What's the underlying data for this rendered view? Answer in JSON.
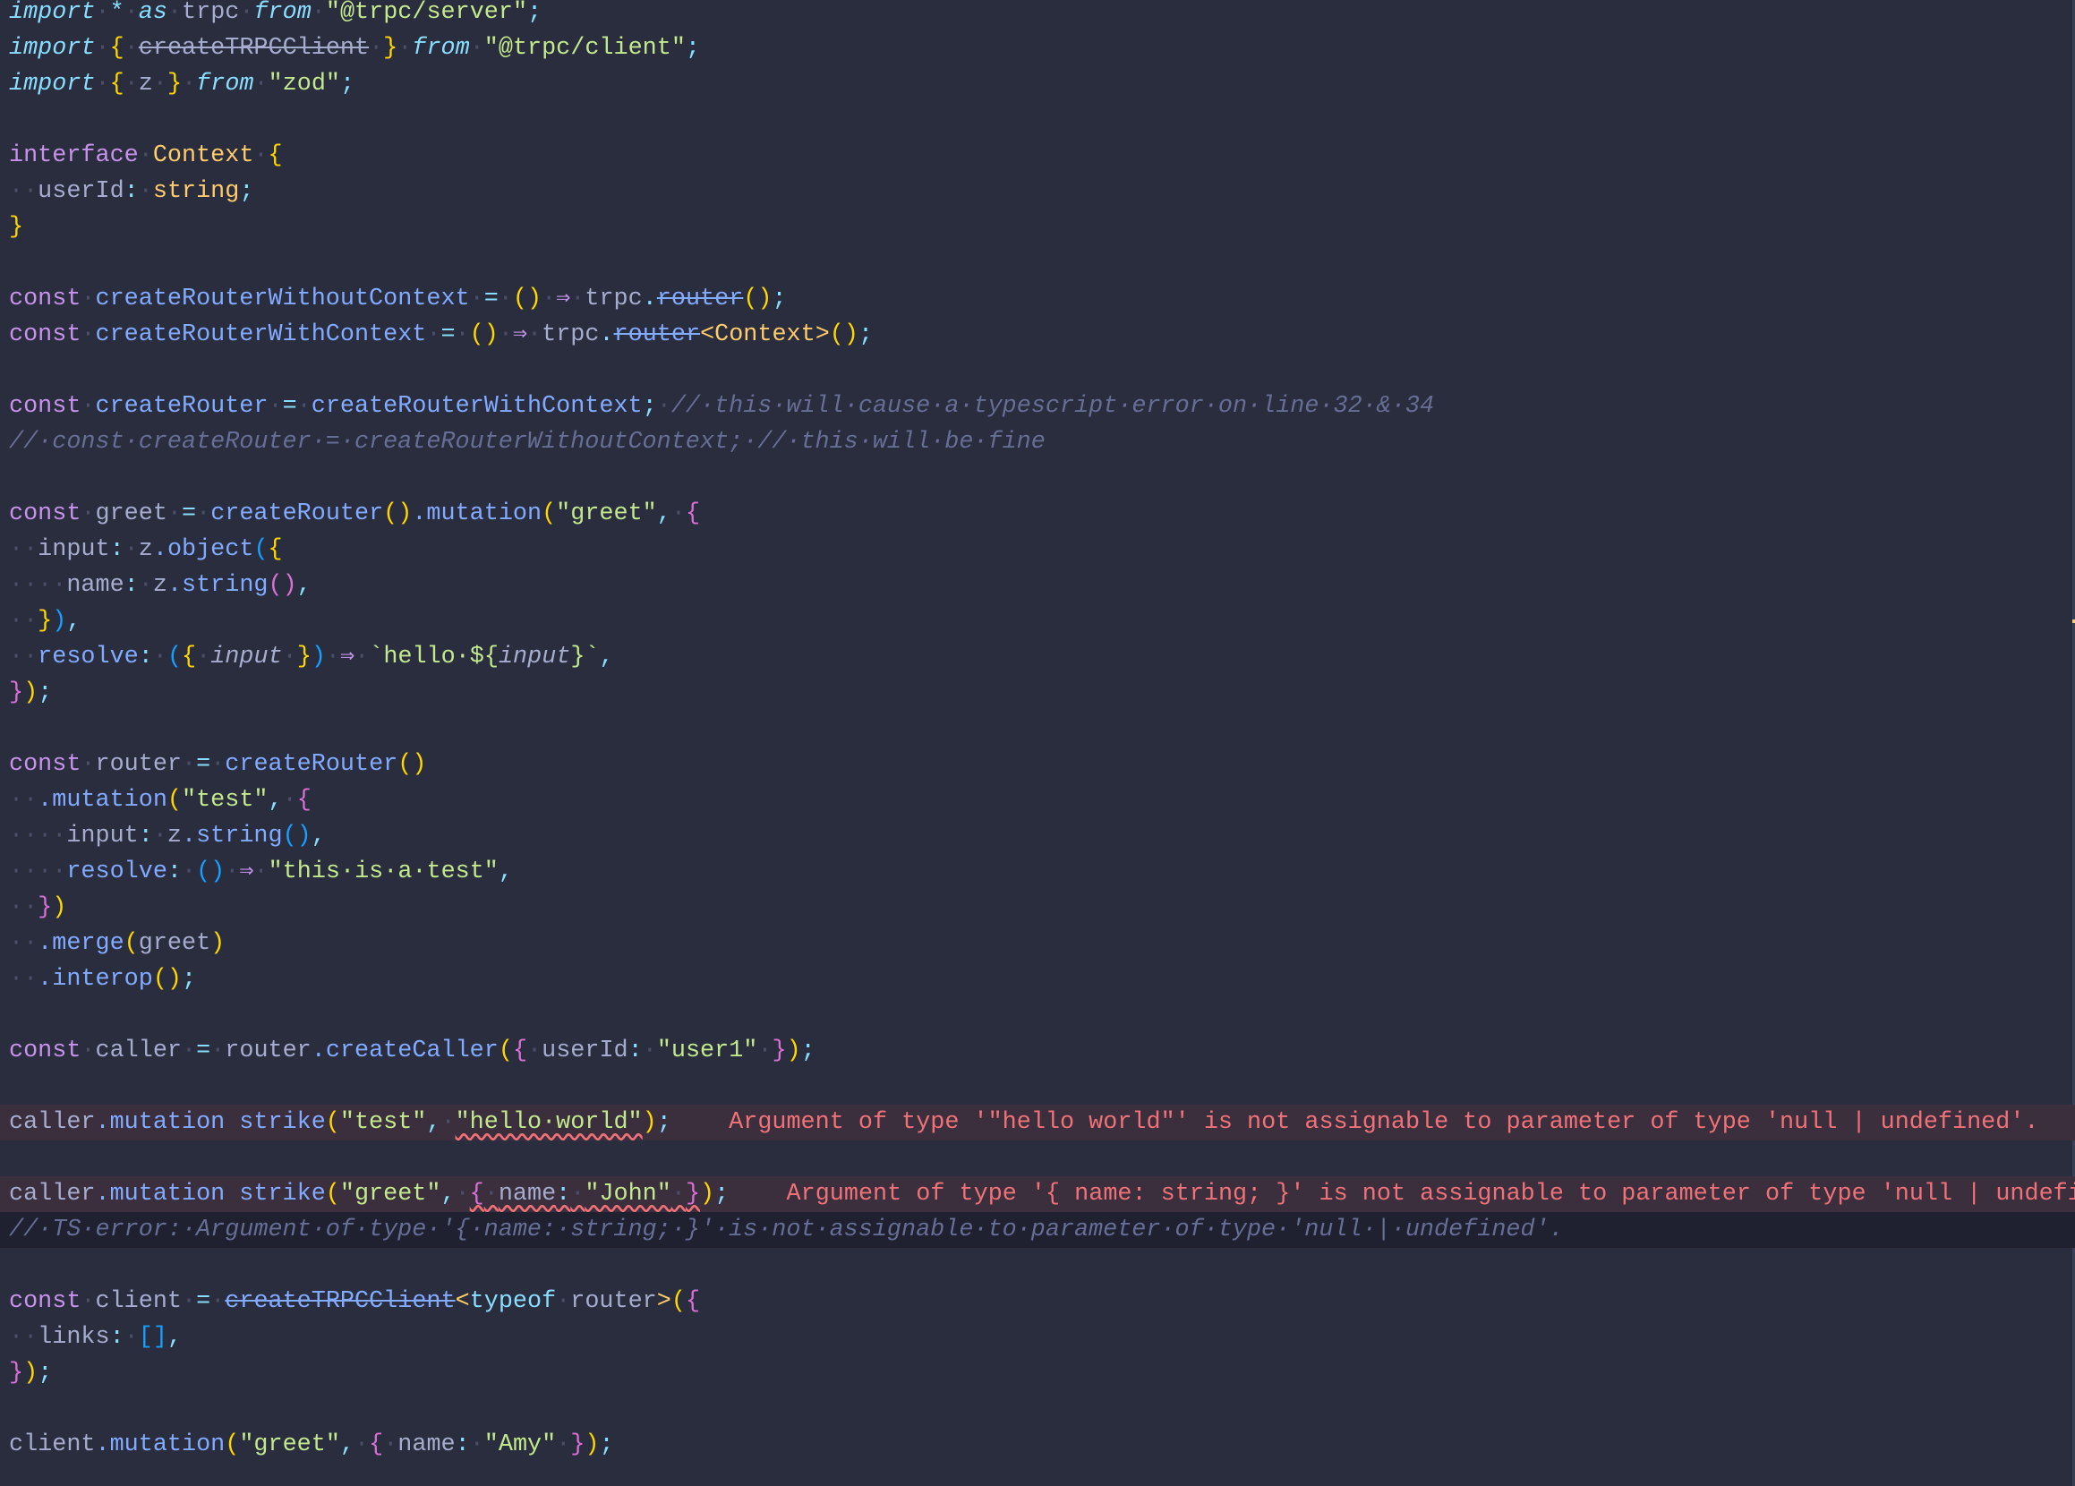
{
  "editor": {
    "language": "typescript",
    "lines": [
      {
        "tokens": [
          [
            "kwi",
            "import"
          ],
          [
            "ws",
            "·"
          ],
          [
            "op",
            "*"
          ],
          [
            "ws",
            "·"
          ],
          [
            "kwi",
            "as"
          ],
          [
            "ws",
            "·"
          ],
          [
            "var",
            "trpc"
          ],
          [
            "ws",
            "·"
          ],
          [
            "kwi",
            "from"
          ],
          [
            "ws",
            "·"
          ],
          [
            "str",
            "\"@trpc/server\""
          ],
          [
            "op",
            ";"
          ]
        ]
      },
      {
        "tokens": [
          [
            "kwi",
            "import"
          ],
          [
            "ws",
            "·"
          ],
          [
            "br1",
            "{"
          ],
          [
            "ws",
            "·"
          ],
          [
            "var strike",
            "createTRPCClient"
          ],
          [
            "ws",
            "·"
          ],
          [
            "br1",
            "}"
          ],
          [
            "ws",
            "·"
          ],
          [
            "kwi",
            "from"
          ],
          [
            "ws",
            "·"
          ],
          [
            "str",
            "\"@trpc/client\""
          ],
          [
            "op",
            ";"
          ]
        ]
      },
      {
        "tokens": [
          [
            "kwi",
            "import"
          ],
          [
            "ws",
            "·"
          ],
          [
            "br1",
            "{"
          ],
          [
            "ws",
            "·"
          ],
          [
            "var",
            "z"
          ],
          [
            "ws",
            "·"
          ],
          [
            "br1",
            "}"
          ],
          [
            "ws",
            "·"
          ],
          [
            "kwi",
            "from"
          ],
          [
            "ws",
            "·"
          ],
          [
            "str",
            "\"zod\""
          ],
          [
            "op",
            ";"
          ]
        ]
      },
      {
        "tokens": []
      },
      {
        "tokens": [
          [
            "kw",
            "interface"
          ],
          [
            "ws",
            "·"
          ],
          [
            "type",
            "Context"
          ],
          [
            "ws",
            "·"
          ],
          [
            "br1",
            "{"
          ]
        ]
      },
      {
        "tokens": [
          [
            "ws",
            "··"
          ],
          [
            "prop",
            "userId"
          ],
          [
            "op",
            ":"
          ],
          [
            "ws",
            "·"
          ],
          [
            "type",
            "string"
          ],
          [
            "op",
            ";"
          ]
        ]
      },
      {
        "tokens": [
          [
            "br1",
            "}"
          ]
        ]
      },
      {
        "tokens": []
      },
      {
        "tokens": [
          [
            "kw",
            "const"
          ],
          [
            "ws",
            "·"
          ],
          [
            "fn",
            "createRouterWithoutContext"
          ],
          [
            "ws",
            "·"
          ],
          [
            "op",
            "="
          ],
          [
            "ws",
            "·"
          ],
          [
            "br1",
            "()"
          ],
          [
            "ws",
            "·"
          ],
          [
            "arrow",
            "⇒"
          ],
          [
            "ws",
            "·"
          ],
          [
            "var",
            "trpc"
          ],
          [
            "op",
            "."
          ],
          [
            "fn strike",
            "router"
          ],
          [
            "br1",
            "()"
          ],
          [
            "op",
            ";"
          ]
        ]
      },
      {
        "tokens": [
          [
            "kw",
            "const"
          ],
          [
            "ws",
            "·"
          ],
          [
            "fn",
            "createRouterWithContext"
          ],
          [
            "ws",
            "·"
          ],
          [
            "op",
            "="
          ],
          [
            "ws",
            "·"
          ],
          [
            "br1",
            "()"
          ],
          [
            "ws",
            "·"
          ],
          [
            "arrow",
            "⇒"
          ],
          [
            "ws",
            "·"
          ],
          [
            "var",
            "trpc"
          ],
          [
            "op",
            "."
          ],
          [
            "fn strike",
            "router"
          ],
          [
            "type",
            "<Context>"
          ],
          [
            "br1",
            "()"
          ],
          [
            "op",
            ";"
          ]
        ]
      },
      {
        "tokens": []
      },
      {
        "tokens": [
          [
            "kw",
            "const"
          ],
          [
            "ws",
            "·"
          ],
          [
            "fn",
            "createRouter"
          ],
          [
            "ws",
            "·"
          ],
          [
            "op",
            "="
          ],
          [
            "ws",
            "·"
          ],
          [
            "fn",
            "createRouterWithContext"
          ],
          [
            "op",
            ";"
          ],
          [
            "ws",
            "·"
          ],
          [
            "cmt",
            "//·this·will·cause·a·typescript·error·on·line·32·&·34"
          ]
        ]
      },
      {
        "tokens": [
          [
            "cmt",
            "//·const·createRouter·=·createRouterWithoutContext;·//·this·will·be·fine"
          ]
        ]
      },
      {
        "tokens": []
      },
      {
        "tokens": [
          [
            "kw",
            "const"
          ],
          [
            "ws",
            "·"
          ],
          [
            "var",
            "greet"
          ],
          [
            "ws",
            "·"
          ],
          [
            "op",
            "="
          ],
          [
            "ws",
            "·"
          ],
          [
            "fn",
            "createRouter"
          ],
          [
            "br1",
            "()"
          ],
          [
            "fn",
            ".mutation"
          ],
          [
            "br1",
            "("
          ],
          [
            "str",
            "\"greet\""
          ],
          [
            "op",
            ","
          ],
          [
            "ws",
            "·"
          ],
          [
            "br2",
            "{"
          ]
        ]
      },
      {
        "tokens": [
          [
            "ws",
            "··"
          ],
          [
            "prop",
            "input"
          ],
          [
            "op",
            ":"
          ],
          [
            "ws",
            "·"
          ],
          [
            "var",
            "z"
          ],
          [
            "fn",
            ".object"
          ],
          [
            "br3",
            "("
          ],
          [
            "br1",
            "{"
          ]
        ]
      },
      {
        "tokens": [
          [
            "ws",
            "····"
          ],
          [
            "prop",
            "name"
          ],
          [
            "op",
            ":"
          ],
          [
            "ws",
            "·"
          ],
          [
            "var",
            "z"
          ],
          [
            "fn",
            ".string"
          ],
          [
            "br2",
            "()"
          ],
          [
            "op",
            ","
          ]
        ]
      },
      {
        "tokens": [
          [
            "ws",
            "··"
          ],
          [
            "br1",
            "}"
          ],
          [
            "br3",
            ")"
          ],
          [
            "op",
            ","
          ]
        ]
      },
      {
        "tokens": [
          [
            "ws",
            "··"
          ],
          [
            "fn",
            "resolve"
          ],
          [
            "op",
            ":"
          ],
          [
            "ws",
            "·"
          ],
          [
            "br3",
            "("
          ],
          [
            "br1",
            "{"
          ],
          [
            "ws",
            "·"
          ],
          [
            "var ital",
            "input"
          ],
          [
            "ws",
            "·"
          ],
          [
            "br1",
            "}"
          ],
          [
            "br3",
            ")"
          ],
          [
            "ws",
            "·"
          ],
          [
            "arrow",
            "⇒"
          ],
          [
            "ws",
            "·"
          ],
          [
            "str",
            "`hello·${"
          ],
          [
            "var ital",
            "input"
          ],
          [
            "str",
            "}`"
          ],
          [
            "op",
            ","
          ]
        ]
      },
      {
        "tokens": [
          [
            "br2",
            "}"
          ],
          [
            "br1",
            ")"
          ],
          [
            "op",
            ";"
          ]
        ]
      },
      {
        "tokens": []
      },
      {
        "tokens": [
          [
            "kw",
            "const"
          ],
          [
            "ws",
            "·"
          ],
          [
            "var",
            "router"
          ],
          [
            "ws",
            "·"
          ],
          [
            "op",
            "="
          ],
          [
            "ws",
            "·"
          ],
          [
            "fn",
            "createRouter"
          ],
          [
            "br1",
            "()"
          ]
        ]
      },
      {
        "tokens": [
          [
            "ws",
            "··"
          ],
          [
            "fn",
            ".mutation"
          ],
          [
            "br1",
            "("
          ],
          [
            "str",
            "\"test\""
          ],
          [
            "op",
            ","
          ],
          [
            "ws",
            "·"
          ],
          [
            "br2",
            "{"
          ]
        ]
      },
      {
        "tokens": [
          [
            "ws",
            "····"
          ],
          [
            "prop",
            "input"
          ],
          [
            "op",
            ":"
          ],
          [
            "ws",
            "·"
          ],
          [
            "var",
            "z"
          ],
          [
            "fn",
            ".string"
          ],
          [
            "br3",
            "()"
          ],
          [
            "op",
            ","
          ]
        ]
      },
      {
        "tokens": [
          [
            "ws",
            "····"
          ],
          [
            "fn",
            "resolve"
          ],
          [
            "op",
            ":"
          ],
          [
            "ws",
            "·"
          ],
          [
            "br3",
            "()"
          ],
          [
            "ws",
            "·"
          ],
          [
            "arrow",
            "⇒"
          ],
          [
            "ws",
            "·"
          ],
          [
            "str",
            "\"this·is·a·test\""
          ],
          [
            "op",
            ","
          ]
        ]
      },
      {
        "tokens": [
          [
            "ws",
            "··"
          ],
          [
            "br2",
            "}"
          ],
          [
            "br1",
            ")"
          ]
        ]
      },
      {
        "tokens": [
          [
            "ws",
            "··"
          ],
          [
            "fn",
            ".merge"
          ],
          [
            "br1",
            "("
          ],
          [
            "var",
            "greet"
          ],
          [
            "br1",
            ")"
          ]
        ]
      },
      {
        "tokens": [
          [
            "ws",
            "··"
          ],
          [
            "fn",
            ".interop"
          ],
          [
            "br1",
            "()"
          ],
          [
            "op",
            ";"
          ]
        ]
      },
      {
        "tokens": []
      },
      {
        "tokens": [
          [
            "kw",
            "const"
          ],
          [
            "ws",
            "·"
          ],
          [
            "var",
            "caller"
          ],
          [
            "ws",
            "·"
          ],
          [
            "op",
            "="
          ],
          [
            "ws",
            "·"
          ],
          [
            "var",
            "router"
          ],
          [
            "fn",
            ".createCaller"
          ],
          [
            "br1",
            "("
          ],
          [
            "br2",
            "{"
          ],
          [
            "ws",
            "·"
          ],
          [
            "prop",
            "userId"
          ],
          [
            "op",
            ":"
          ],
          [
            "ws",
            "·"
          ],
          [
            "str",
            "\"user1\""
          ],
          [
            "ws",
            "·"
          ],
          [
            "br2",
            "}"
          ],
          [
            "br1",
            ")"
          ],
          [
            "op",
            ";"
          ]
        ]
      },
      {
        "tokens": []
      },
      {
        "style": "err",
        "tokens": [
          [
            "var",
            "caller"
          ],
          [
            "fn",
            ".mutation strike"
          ],
          [
            "br1",
            "("
          ],
          [
            "str",
            "\"test\""
          ],
          [
            "op",
            ","
          ],
          [
            "ws",
            "·"
          ],
          [
            "str squig",
            "\"hello·world\""
          ],
          [
            "br1",
            ")"
          ],
          [
            "op",
            ";"
          ],
          [
            "errmsg",
            "    Argument of type '\"hello world\"' is not assignable to parameter of type 'null | undefined'."
          ]
        ]
      },
      {
        "tokens": []
      },
      {
        "style": "err",
        "tokens": [
          [
            "var",
            "caller"
          ],
          [
            "fn",
            ".mutation strike"
          ],
          [
            "br1",
            "("
          ],
          [
            "str",
            "\"greet\""
          ],
          [
            "op",
            ","
          ],
          [
            "ws",
            "·"
          ],
          [
            "br2 squig",
            "{"
          ],
          [
            "ws squig",
            "·"
          ],
          [
            "prop squig",
            "name"
          ],
          [
            "op squig",
            ":"
          ],
          [
            "ws squig",
            "·"
          ],
          [
            "str squig",
            "\"John\""
          ],
          [
            "ws squig",
            "·"
          ],
          [
            "br2 squig",
            "}"
          ],
          [
            "br1",
            ")"
          ],
          [
            "op",
            ";"
          ],
          [
            "errmsg",
            "    Argument of type '{ name: string; }' is not assignable to parameter of type 'null | undefined'."
          ]
        ]
      },
      {
        "style": "cmtbg",
        "tokens": [
          [
            "cmt",
            "//·TS·error:·Argument·of·type·'{·name:·string;·}'·is·not·assignable·to·parameter·of·type·'null·|·undefined'."
          ]
        ]
      },
      {
        "tokens": []
      },
      {
        "tokens": [
          [
            "kw",
            "const"
          ],
          [
            "ws",
            "·"
          ],
          [
            "var",
            "client"
          ],
          [
            "ws",
            "·"
          ],
          [
            "op",
            "="
          ],
          [
            "ws",
            "·"
          ],
          [
            "fn strike",
            "createTRPCClient"
          ],
          [
            "type",
            "<"
          ],
          [
            "op",
            "typeof"
          ],
          [
            "ws",
            "·"
          ],
          [
            "var",
            "router"
          ],
          [
            "type",
            ">"
          ],
          [
            "br1",
            "("
          ],
          [
            "br2",
            "{"
          ]
        ]
      },
      {
        "tokens": [
          [
            "ws",
            "··"
          ],
          [
            "prop",
            "links"
          ],
          [
            "op",
            ":"
          ],
          [
            "ws",
            "·"
          ],
          [
            "br3",
            "[]"
          ],
          [
            "op",
            ","
          ]
        ]
      },
      {
        "tokens": [
          [
            "br2",
            "}"
          ],
          [
            "br1",
            ")"
          ],
          [
            "op",
            ";"
          ]
        ]
      },
      {
        "tokens": []
      },
      {
        "tokens": [
          [
            "var",
            "client"
          ],
          [
            "fn",
            ".mutation"
          ],
          [
            "br1",
            "("
          ],
          [
            "str",
            "\"greet\""
          ],
          [
            "op",
            ","
          ],
          [
            "ws",
            "·"
          ],
          [
            "br2",
            "{"
          ],
          [
            "ws",
            "·"
          ],
          [
            "prop",
            "name"
          ],
          [
            "op",
            ":"
          ],
          [
            "ws",
            "·"
          ],
          [
            "str",
            "\"Amy\""
          ],
          [
            "ws",
            "·"
          ],
          [
            "br2",
            "}"
          ],
          [
            "br1",
            ")"
          ],
          [
            "op",
            ";"
          ]
        ]
      }
    ]
  },
  "colors": {
    "background": "#2a2d3e",
    "error_line_bg": "#3b2f3e",
    "error_text": "#f07178",
    "keyword": "#c792ea",
    "function": "#82aaff",
    "string": "#c3e88d",
    "type": "#ffcb6b",
    "comment": "#676e95"
  }
}
